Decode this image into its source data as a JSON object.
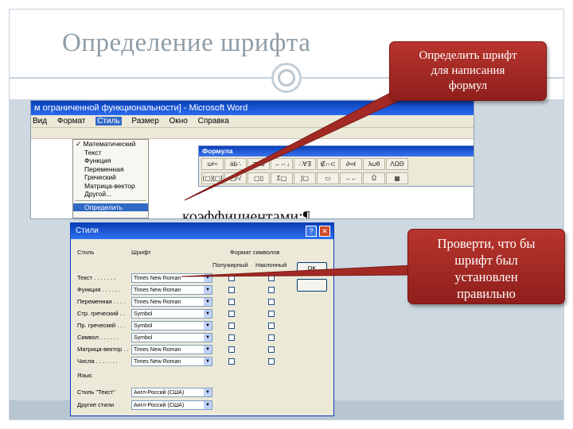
{
  "slide": {
    "title": "Определение шрифта"
  },
  "colors": {
    "callout_red": "#a02a24",
    "title_gray": "#8e9da8",
    "xp_blue": "#0a3fb8",
    "dialog_gray": "#ece9d8"
  },
  "callouts": [
    {
      "text": "Определить шрифт\nдля написания\nформул"
    },
    {
      "text": "Проверти, что бы\nшрифт был\nустановлен\nправильно"
    }
  ],
  "word_window": {
    "title": "м ограниченной функциональности] - Microsoft Word",
    "menu": [
      "Вид",
      "Формат",
      "Стиль",
      "Размер",
      "Окно",
      "Справка"
    ],
    "active_menu_index": 2,
    "style_menu_items": [
      "Математический",
      "Текст",
      "Функция",
      "Переменная",
      "Греческий",
      "Матрица-вектор",
      "Другой..."
    ],
    "style_menu_checked_index": 0,
    "style_menu_highlight": "Определить",
    "formula_toolbar_title": "Формула",
    "formula_row1": [
      "≤≠≈",
      "ȧb∴",
      "∓•⊗",
      "→⇔↓",
      "∴∀∃",
      "∉∩⊂",
      "∂∞ℓ",
      "λωθ",
      "ΛΩΘ"
    ],
    "formula_row2": [
      "(▢)[▢]",
      "▢/√",
      "▢▯",
      "Σ▢",
      "∫▢",
      "▭",
      "→←",
      "Ů",
      "▦"
    ],
    "doc_text": "коэффициентами:¶"
  },
  "style_dialog": {
    "title": "Стили",
    "col_style": "Стиль",
    "col_font": "Шрифт",
    "col_format": "Формат символов",
    "col_bold": "Полужирный",
    "col_italic": "Наклонный",
    "ok_label": "OK",
    "rows": [
      {
        "style": "Текст . . . . . . .",
        "font": "Times New Roman"
      },
      {
        "style": "Функция . . . . . .",
        "font": "Times New Roman"
      },
      {
        "style": "Переменная . . . .",
        "font": "Times New Roman"
      },
      {
        "style": "Стр. греческий . .",
        "font": "Symbol"
      },
      {
        "style": "Пр. греческий . . .",
        "font": "Symbol"
      },
      {
        "style": "Символ . . . . . .",
        "font": "Symbol"
      },
      {
        "style": "Матрица-вектор . .",
        "font": "Times New Roman"
      },
      {
        "style": "Числа . . . . . . .",
        "font": "Times New Roman"
      }
    ],
    "language_label": "Язык:",
    "language_rows": [
      {
        "style": "Стиль \"Текст\"",
        "font": "Англ-Россий (США)"
      },
      {
        "style": "Другие стили",
        "font": "Англ-Россий (США)"
      }
    ]
  }
}
